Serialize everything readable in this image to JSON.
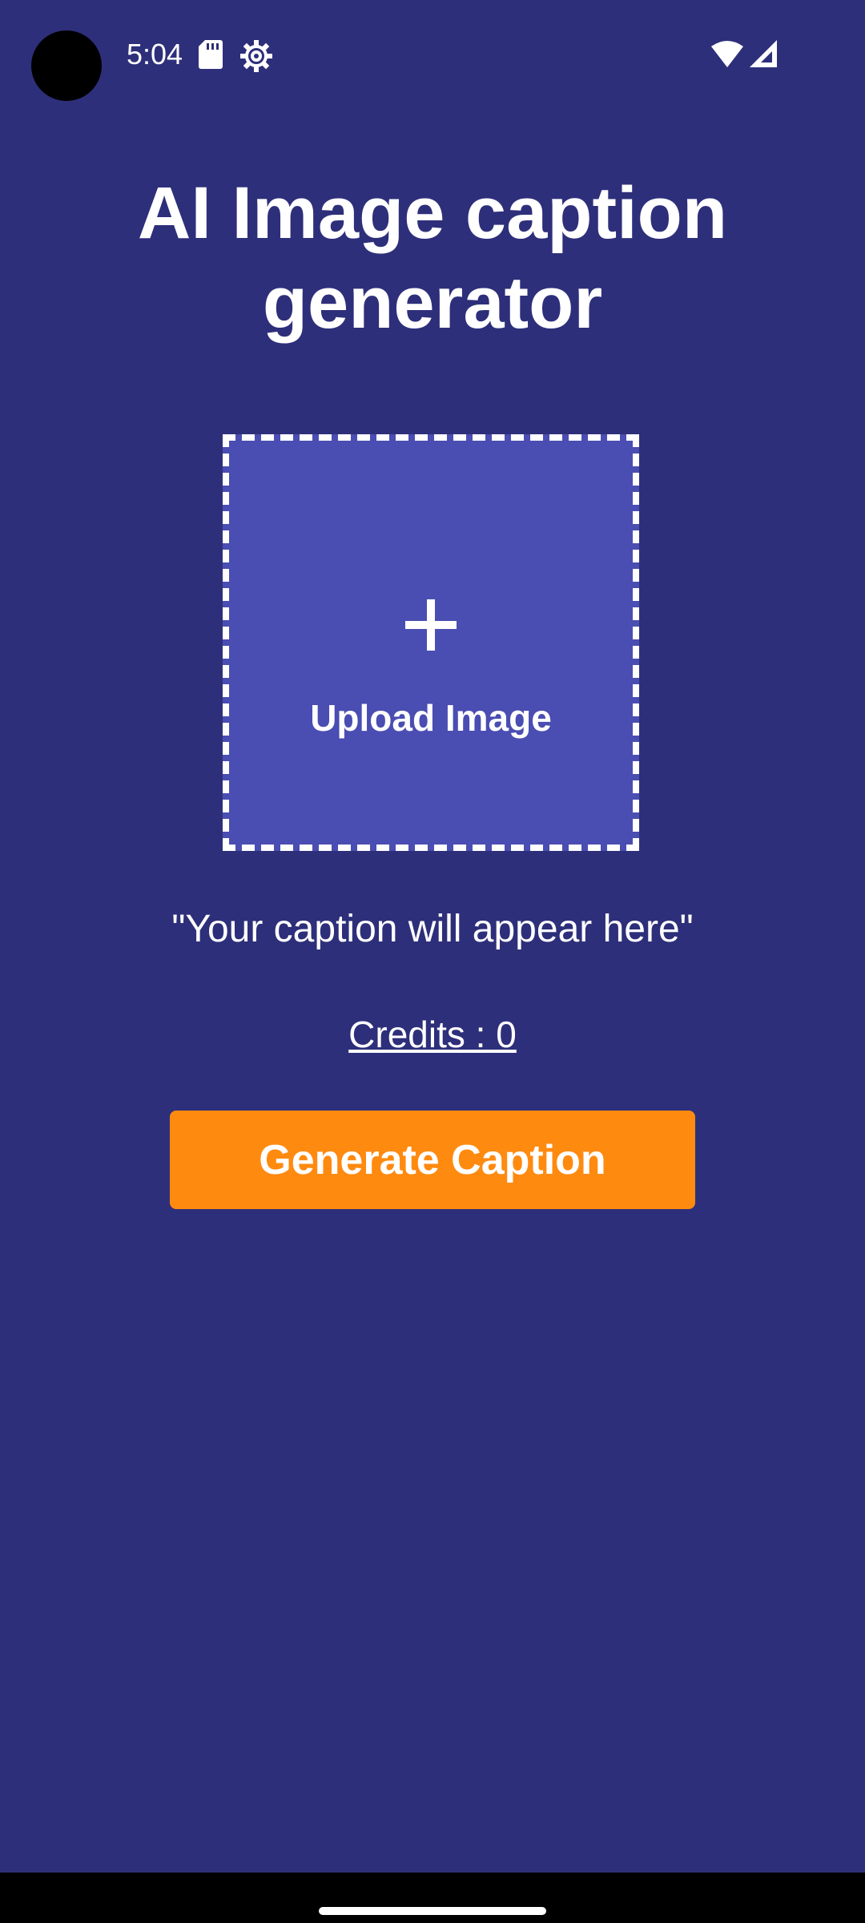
{
  "status_bar": {
    "time": "5:04",
    "icons": [
      "sd-card-icon",
      "gear-icon",
      "wifi-icon",
      "cell-signal-icon"
    ]
  },
  "page": {
    "title": "AI Image caption generator"
  },
  "upload": {
    "icon": "plus-icon",
    "label": "Upload Image"
  },
  "caption": {
    "text": "\"Your caption will appear here\""
  },
  "credits": {
    "text": "Credits : 0"
  },
  "actions": {
    "generate_label": "Generate Caption"
  },
  "colors": {
    "background": "#2E2F7A",
    "upload_fill": "#4A4DB1",
    "accent": "#FF8A10",
    "text": "#FFFFFF"
  }
}
